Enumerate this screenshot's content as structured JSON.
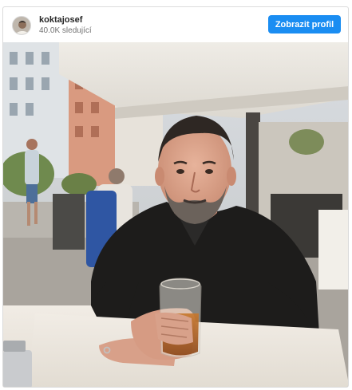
{
  "post": {
    "username": "koktajosef",
    "followers": "40.0K sledující",
    "profile_button_label": "Zobrazit profil",
    "avatar_icon": "avatar",
    "photo": "restaurant-portrait-photo"
  },
  "colors": {
    "accent": "#1a8df2",
    "username": "#262626",
    "secondary_text": "#737373",
    "border": "#dbdbdb"
  }
}
